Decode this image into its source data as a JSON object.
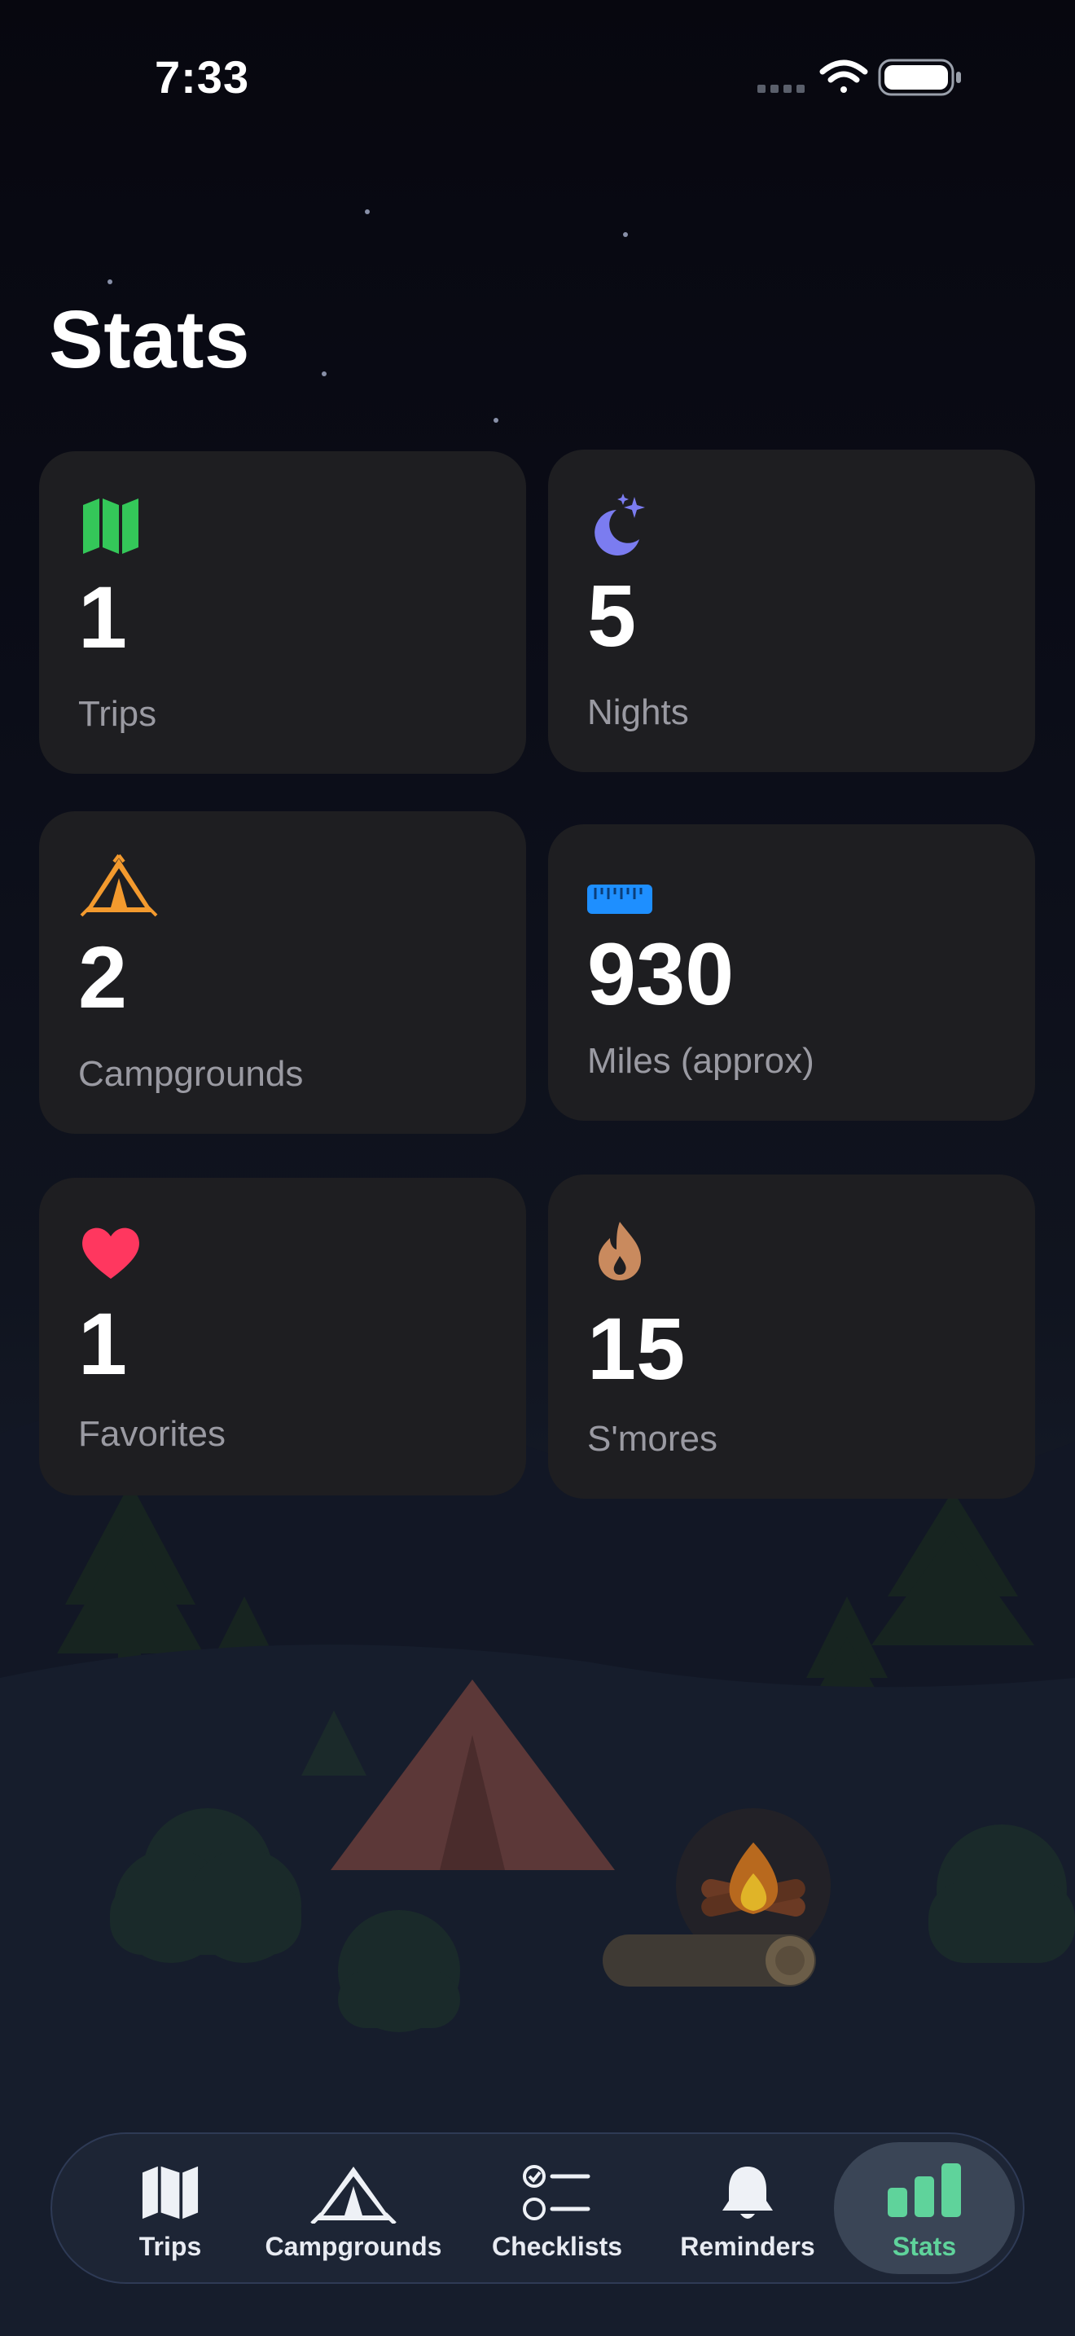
{
  "status_bar": {
    "time": "7:33"
  },
  "page": {
    "title": "Stats"
  },
  "stats": [
    {
      "value": "1",
      "label": "Trips",
      "icon": "map-icon",
      "color": "#34c759"
    },
    {
      "value": "5",
      "label": "Nights",
      "icon": "moon-stars-icon",
      "color": "#7b7cf0"
    },
    {
      "value": "2",
      "label": "Campgrounds",
      "icon": "tent-icon",
      "color": "#f39a2e"
    },
    {
      "value": "930",
      "label": "Miles (approx)",
      "icon": "ruler-icon",
      "color": "#1e8fff"
    },
    {
      "value": "1",
      "label": "Favorites",
      "icon": "heart-icon",
      "color": "#ff375f"
    },
    {
      "value": "15",
      "label": "S'mores",
      "icon": "flame-icon",
      "color": "#c98a5e"
    }
  ],
  "tabbar": {
    "tabs": [
      {
        "label": "Trips",
        "icon": "map-icon"
      },
      {
        "label": "Campgrounds",
        "icon": "tent-icon"
      },
      {
        "label": "Checklists",
        "icon": "checklist-icon"
      },
      {
        "label": "Reminders",
        "icon": "bell-icon"
      },
      {
        "label": "Stats",
        "icon": "bar-chart-icon",
        "active": true
      }
    ],
    "accent": "#5fd39b"
  }
}
